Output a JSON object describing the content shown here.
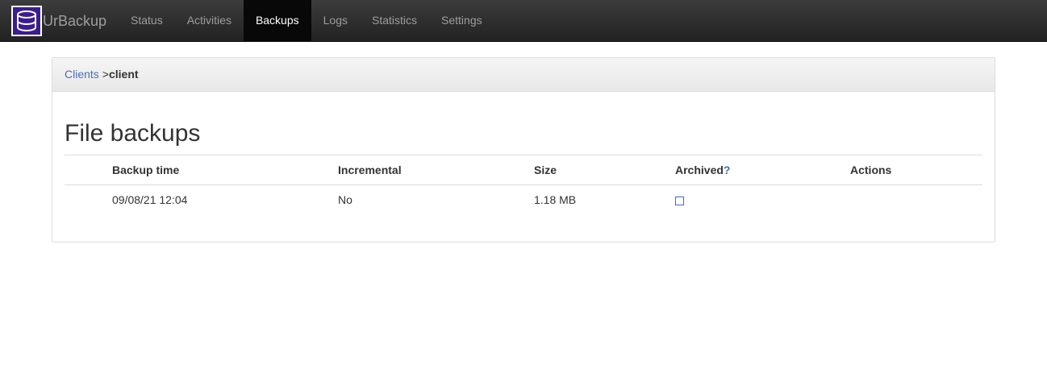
{
  "app": {
    "brand": "UrBackup",
    "logo_icon": "database-icon",
    "logo_color": "#3b1d8f"
  },
  "nav": {
    "items": [
      {
        "label": "Status"
      },
      {
        "label": "Activities"
      },
      {
        "label": "Backups",
        "active": true
      },
      {
        "label": "Logs"
      },
      {
        "label": "Statistics"
      },
      {
        "label": "Settings"
      }
    ]
  },
  "breadcrumb": {
    "link": "Clients",
    "separator": ">",
    "current": "client"
  },
  "section": {
    "title": "File backups"
  },
  "table": {
    "columns": {
      "backup_time": "Backup time",
      "incremental": "Incremental",
      "size": "Size",
      "archived": "Archived",
      "archived_help": "?",
      "actions": "Actions"
    },
    "rows": [
      {
        "backup_time": "09/08/21 12:04",
        "incremental": "No",
        "size": "1.18 MB",
        "archived": false,
        "actions": ""
      }
    ]
  }
}
